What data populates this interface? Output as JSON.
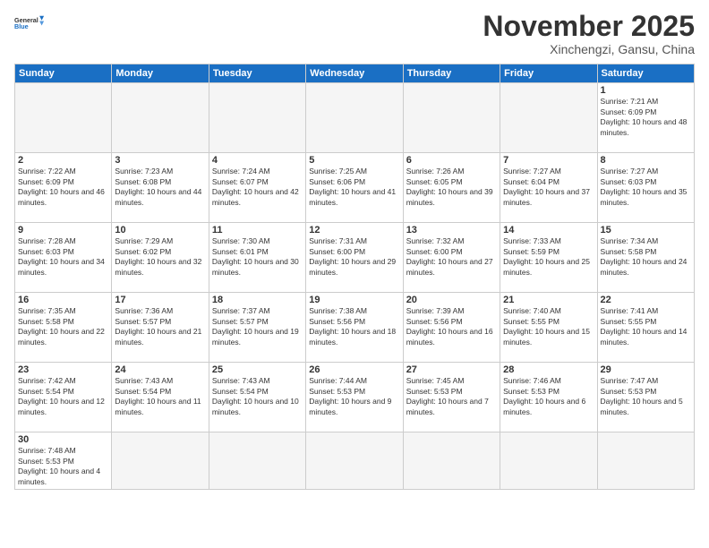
{
  "logo": {
    "text_general": "General",
    "text_blue": "Blue"
  },
  "header": {
    "month_year": "November 2025",
    "location": "Xinchengzi, Gansu, China"
  },
  "weekdays": [
    "Sunday",
    "Monday",
    "Tuesday",
    "Wednesday",
    "Thursday",
    "Friday",
    "Saturday"
  ],
  "weeks": [
    [
      null,
      null,
      null,
      null,
      null,
      null,
      {
        "day": "1",
        "sunrise": "7:21 AM",
        "sunset": "6:09 PM",
        "daylight": "10 hours and 48 minutes."
      }
    ],
    [
      {
        "day": "2",
        "sunrise": "7:22 AM",
        "sunset": "6:09 PM",
        "daylight": "10 hours and 46 minutes."
      },
      {
        "day": "3",
        "sunrise": "7:23 AM",
        "sunset": "6:08 PM",
        "daylight": "10 hours and 44 minutes."
      },
      {
        "day": "4",
        "sunrise": "7:24 AM",
        "sunset": "6:07 PM",
        "daylight": "10 hours and 42 minutes."
      },
      {
        "day": "5",
        "sunrise": "7:25 AM",
        "sunset": "6:06 PM",
        "daylight": "10 hours and 41 minutes."
      },
      {
        "day": "6",
        "sunrise": "7:26 AM",
        "sunset": "6:05 PM",
        "daylight": "10 hours and 39 minutes."
      },
      {
        "day": "7",
        "sunrise": "7:27 AM",
        "sunset": "6:04 PM",
        "daylight": "10 hours and 37 minutes."
      },
      {
        "day": "8",
        "sunrise": "7:27 AM",
        "sunset": "6:03 PM",
        "daylight": "10 hours and 35 minutes."
      }
    ],
    [
      {
        "day": "9",
        "sunrise": "7:28 AM",
        "sunset": "6:03 PM",
        "daylight": "10 hours and 34 minutes."
      },
      {
        "day": "10",
        "sunrise": "7:29 AM",
        "sunset": "6:02 PM",
        "daylight": "10 hours and 32 minutes."
      },
      {
        "day": "11",
        "sunrise": "7:30 AM",
        "sunset": "6:01 PM",
        "daylight": "10 hours and 30 minutes."
      },
      {
        "day": "12",
        "sunrise": "7:31 AM",
        "sunset": "6:00 PM",
        "daylight": "10 hours and 29 minutes."
      },
      {
        "day": "13",
        "sunrise": "7:32 AM",
        "sunset": "6:00 PM",
        "daylight": "10 hours and 27 minutes."
      },
      {
        "day": "14",
        "sunrise": "7:33 AM",
        "sunset": "5:59 PM",
        "daylight": "10 hours and 25 minutes."
      },
      {
        "day": "15",
        "sunrise": "7:34 AM",
        "sunset": "5:58 PM",
        "daylight": "10 hours and 24 minutes."
      }
    ],
    [
      {
        "day": "16",
        "sunrise": "7:35 AM",
        "sunset": "5:58 PM",
        "daylight": "10 hours and 22 minutes."
      },
      {
        "day": "17",
        "sunrise": "7:36 AM",
        "sunset": "5:57 PM",
        "daylight": "10 hours and 21 minutes."
      },
      {
        "day": "18",
        "sunrise": "7:37 AM",
        "sunset": "5:57 PM",
        "daylight": "10 hours and 19 minutes."
      },
      {
        "day": "19",
        "sunrise": "7:38 AM",
        "sunset": "5:56 PM",
        "daylight": "10 hours and 18 minutes."
      },
      {
        "day": "20",
        "sunrise": "7:39 AM",
        "sunset": "5:56 PM",
        "daylight": "10 hours and 16 minutes."
      },
      {
        "day": "21",
        "sunrise": "7:40 AM",
        "sunset": "5:55 PM",
        "daylight": "10 hours and 15 minutes."
      },
      {
        "day": "22",
        "sunrise": "7:41 AM",
        "sunset": "5:55 PM",
        "daylight": "10 hours and 14 minutes."
      }
    ],
    [
      {
        "day": "23",
        "sunrise": "7:42 AM",
        "sunset": "5:54 PM",
        "daylight": "10 hours and 12 minutes."
      },
      {
        "day": "24",
        "sunrise": "7:43 AM",
        "sunset": "5:54 PM",
        "daylight": "10 hours and 11 minutes."
      },
      {
        "day": "25",
        "sunrise": "7:43 AM",
        "sunset": "5:54 PM",
        "daylight": "10 hours and 10 minutes."
      },
      {
        "day": "26",
        "sunrise": "7:44 AM",
        "sunset": "5:53 PM",
        "daylight": "10 hours and 9 minutes."
      },
      {
        "day": "27",
        "sunrise": "7:45 AM",
        "sunset": "5:53 PM",
        "daylight": "10 hours and 7 minutes."
      },
      {
        "day": "28",
        "sunrise": "7:46 AM",
        "sunset": "5:53 PM",
        "daylight": "10 hours and 6 minutes."
      },
      {
        "day": "29",
        "sunrise": "7:47 AM",
        "sunset": "5:53 PM",
        "daylight": "10 hours and 5 minutes."
      }
    ],
    [
      {
        "day": "30",
        "sunrise": "7:48 AM",
        "sunset": "5:53 PM",
        "daylight": "10 hours and 4 minutes."
      },
      null,
      null,
      null,
      null,
      null,
      null
    ]
  ]
}
